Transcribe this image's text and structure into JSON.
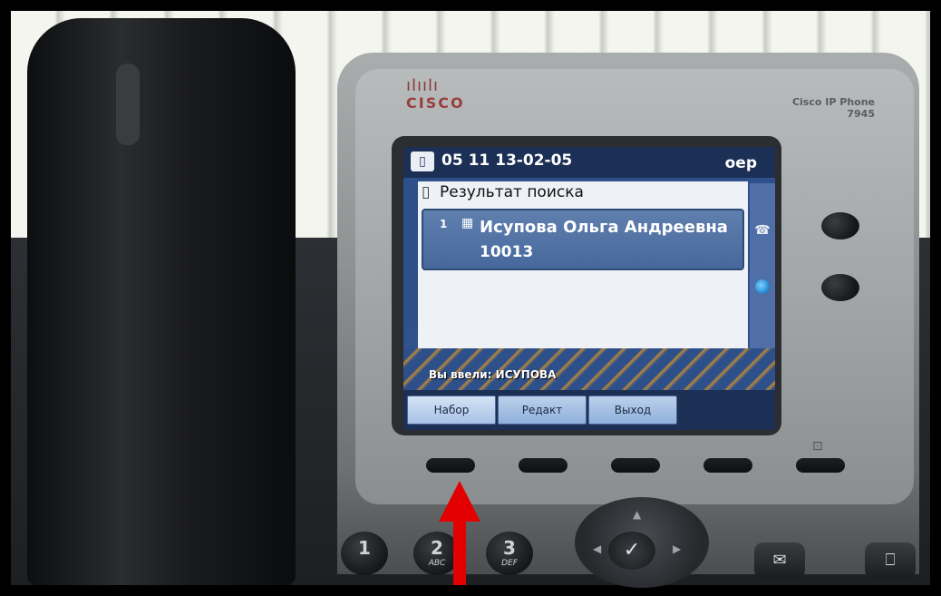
{
  "brand": {
    "logo_bars": "ılıılı",
    "logo_word": "CISCO",
    "model_line1": "Cisco IP Phone",
    "model_line2": "7945"
  },
  "screen": {
    "header": {
      "date_time": "05 11 13-02-05",
      "user": "oep",
      "icon": "book-icon"
    },
    "panel": {
      "title": "Результат поиска",
      "results": [
        {
          "index": "1",
          "name": "Исупова Ольга Андреевна",
          "extension": "10013"
        }
      ]
    },
    "typed_query": "Вы ввели: ИСУПОВА",
    "softkeys": [
      {
        "label": "Набор",
        "selected": true
      },
      {
        "label": "Редакт",
        "selected": false
      },
      {
        "label": "Выход",
        "selected": false
      }
    ],
    "side_icons": [
      "phone-line-icon",
      "globe-icon"
    ]
  },
  "keypad": [
    {
      "digit": "1",
      "letters": ""
    },
    {
      "digit": "2",
      "letters": "ABC"
    },
    {
      "digit": "3",
      "letters": "DEF"
    }
  ],
  "nav": {
    "center_glyph": "✓"
  },
  "function_buttons": [
    {
      "icon": "envelope-icon",
      "glyph": "✉",
      "label": "messages"
    },
    {
      "icon": "book-icon",
      "glyph": "⎕",
      "label": "directories"
    }
  ],
  "colors": {
    "arrow": "#e30000",
    "screen_blue": "#2d4f8a",
    "softkey_blue": "#8fb0dc"
  }
}
